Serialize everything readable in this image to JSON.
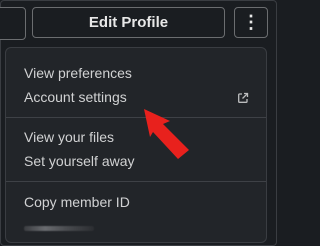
{
  "header": {
    "edit_profile_label": "Edit Profile",
    "more_label": "⋮"
  },
  "menu": {
    "items": [
      {
        "label": "View preferences"
      },
      {
        "label": "Account settings",
        "icon": "external-link-icon"
      },
      {
        "label": "View your files"
      },
      {
        "label": "Set yourself away"
      },
      {
        "label": "Copy member ID"
      }
    ]
  },
  "colors": {
    "background": "#1a1d21",
    "menu_background": "#222529",
    "text": "#d1d2d3",
    "annotation_arrow": "#e8211d"
  }
}
